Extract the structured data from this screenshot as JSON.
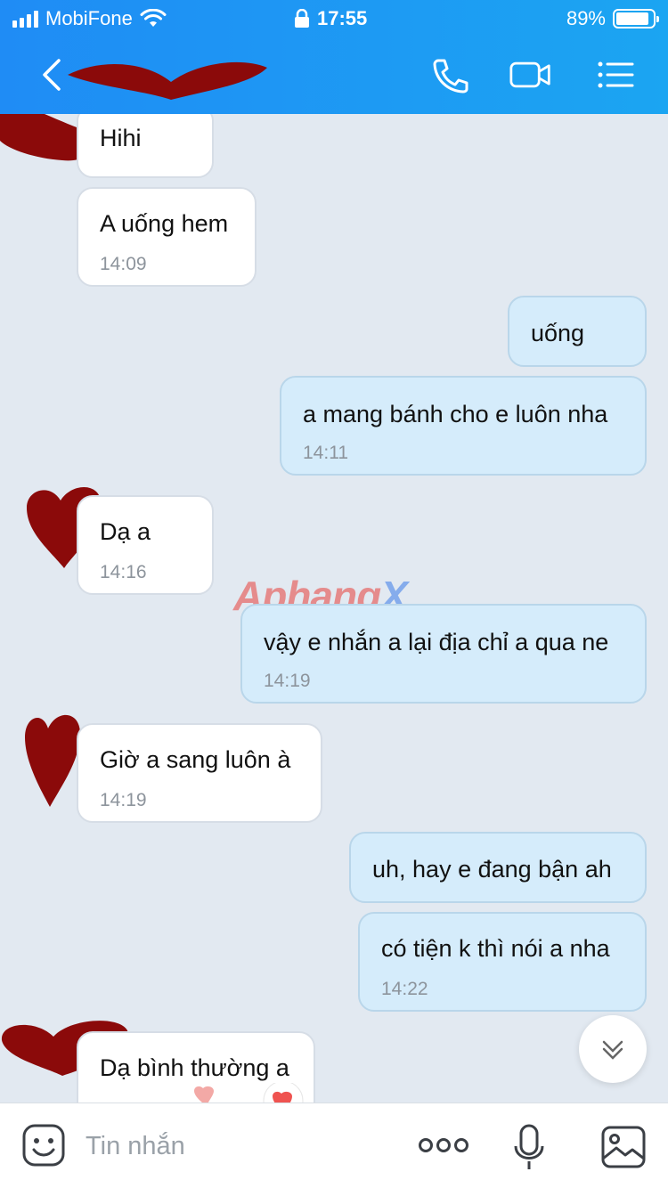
{
  "status_bar": {
    "carrier": "MobiFone",
    "time": "17:55",
    "battery_percent": "89%",
    "battery_level": 0.89
  },
  "header": {
    "contact_name": "",
    "icons": [
      "back-chevron-icon",
      "phone-icon",
      "video-call-icon",
      "menu-list-icon"
    ]
  },
  "watermark": {
    "part1": "Aphang",
    "part2": "X"
  },
  "messages": [
    {
      "side": "in",
      "text": "Hihi",
      "time": ""
    },
    {
      "side": "in",
      "text": "A uống hem",
      "time": "14:09"
    },
    {
      "side": "out",
      "text": "uống",
      "time": ""
    },
    {
      "side": "out",
      "text": "a mang bánh cho e luôn nha",
      "time": "14:11"
    },
    {
      "side": "in",
      "text": "Dạ a",
      "time": "14:16"
    },
    {
      "side": "out",
      "text": "vậy e nhắn a lại địa chỉ a qua ne",
      "time": "14:19"
    },
    {
      "side": "in",
      "text": "Giờ a sang luôn à",
      "time": "14:19"
    },
    {
      "side": "out",
      "text": "uh, hay e đang bận ah",
      "time": ""
    },
    {
      "side": "out",
      "text": "có tiện k thì nói a nha",
      "time": "14:22"
    },
    {
      "side": "in",
      "text": "Dạ bình thường a",
      "time": ""
    }
  ],
  "composer": {
    "placeholder": "Tin nhắn",
    "icons": [
      "emoji-sticker-icon",
      "more-dots-icon",
      "microphone-icon",
      "image-icon"
    ]
  },
  "colors": {
    "header_blue": "#1d9bf3",
    "chat_bg": "#e2e9f1",
    "bubble_out": "#d5ecfb",
    "bubble_in": "#ffffff",
    "scribble": "#8b0a0a"
  }
}
